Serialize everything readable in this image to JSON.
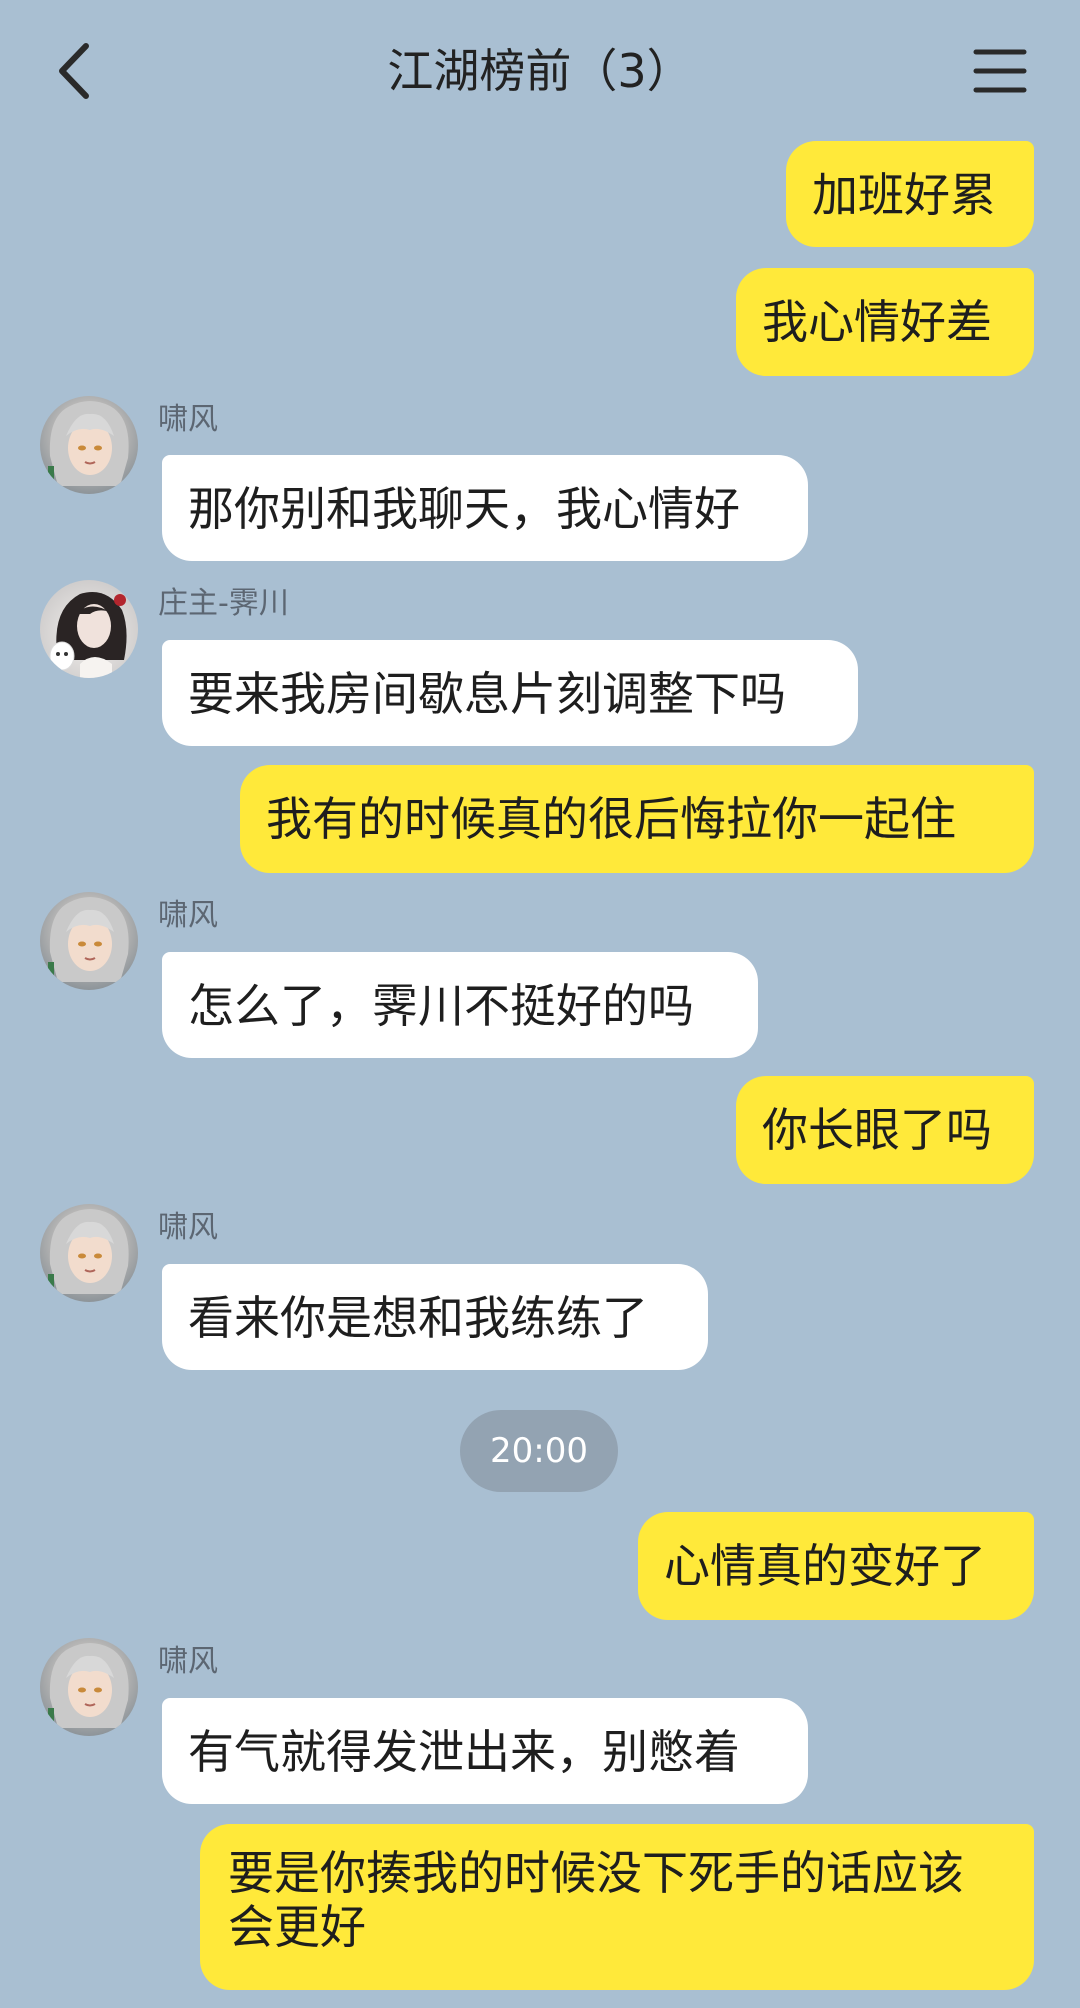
{
  "header": {
    "title": "江湖榜前（3）",
    "back_icon": "chevron-left-icon",
    "menu_icon": "hamburger-menu-icon"
  },
  "colors": {
    "background": "#a9bfd2",
    "outgoing_bubble": "#ffe93a",
    "incoming_bubble": "#ffffff",
    "time_pill": "#93a3b2"
  },
  "messages": [
    {
      "side": "out",
      "text": "加班好累"
    },
    {
      "side": "out",
      "text": "我心情好差"
    },
    {
      "side": "in",
      "sender": "啸风",
      "text": "那你别和我聊天，我心情好"
    },
    {
      "side": "in",
      "sender": "庄主-霁川",
      "text": "要来我房间歇息片刻调整下吗"
    },
    {
      "side": "out",
      "text": "我有的时候真的很后悔拉你一起住"
    },
    {
      "side": "in",
      "sender": "啸风",
      "text": "怎么了，霁川不挺好的吗"
    },
    {
      "side": "out",
      "text": "你长眼了吗"
    },
    {
      "side": "in",
      "sender": "啸风",
      "text": "看来你是想和我练练了"
    },
    {
      "side": "out",
      "text": "心情真的变好了"
    },
    {
      "side": "in",
      "sender": "啸风",
      "text": "有气就得发泄出来，别憋着"
    },
    {
      "side": "out",
      "text": "要是你揍我的时候没下死手的话应该会更好"
    }
  ],
  "timestamp": "20:00"
}
